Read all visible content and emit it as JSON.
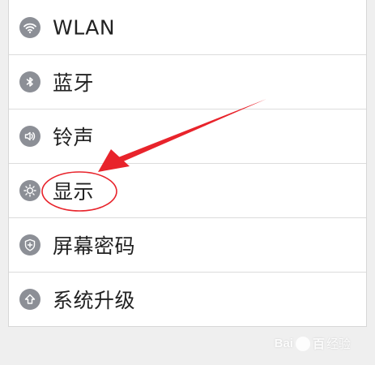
{
  "settings": {
    "items": [
      {
        "label": "WLAN",
        "icon": "wifi-icon"
      },
      {
        "label": "蓝牙",
        "icon": "bluetooth-icon"
      },
      {
        "label": "铃声",
        "icon": "speaker-icon"
      },
      {
        "label": "显示",
        "icon": "brightness-icon"
      },
      {
        "label": "屏幕密码",
        "icon": "shield-icon"
      },
      {
        "label": "系统升级",
        "icon": "upgrade-arrow-icon"
      }
    ]
  },
  "annotation": {
    "color": "#e8232b",
    "highlighted_item": "显示"
  },
  "watermark": {
    "brand_left": "Bai",
    "brand_right": "百",
    "suffix": "经验"
  },
  "colors": {
    "icon_bg": "#8c8f96",
    "page_bg": "#efefef",
    "list_bg": "#ffffff"
  }
}
